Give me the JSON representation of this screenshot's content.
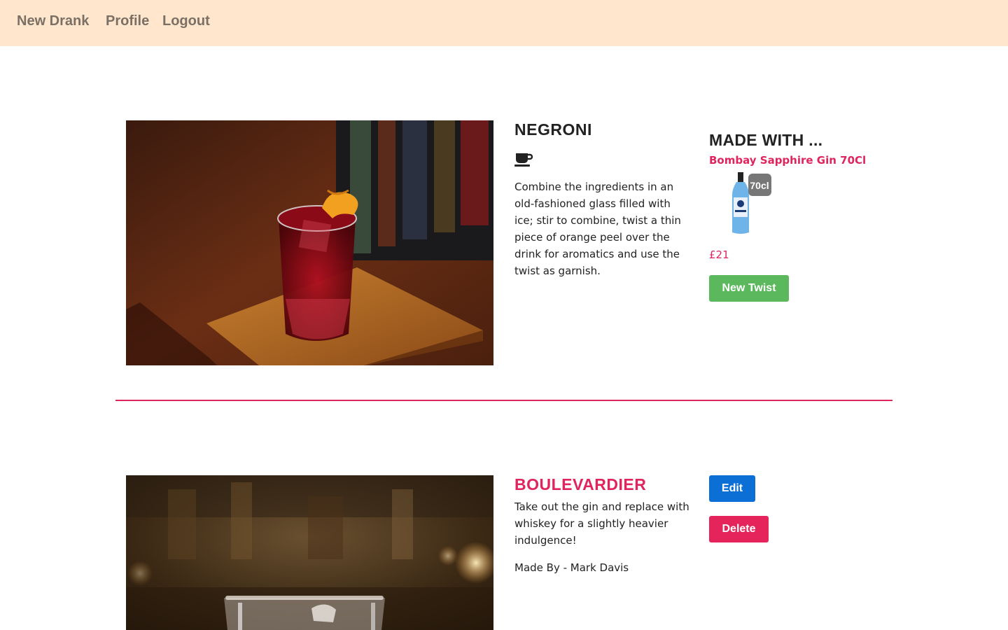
{
  "nav": {
    "links": [
      "New Drank",
      "Profile",
      "Logout"
    ]
  },
  "drinks": [
    {
      "title": "NEGRONI",
      "title_color": "#222222",
      "icon": "coffee-cup-icon",
      "description": "Combine the ingredients in an old-fashioned glass filled with ice; stir to combine, twist a thin piece of orange peel over the drink for aromatics and use the twist as garnish.",
      "image": "negroni-cocktail-photo",
      "made_with": {
        "heading": "MADE WITH ...",
        "product_name": "Bombay Sapphire Gin 70Cl",
        "bottle_badge": "70cl",
        "price": "£21"
      },
      "button": "New Twist"
    },
    {
      "title": "BOULEVARDIER",
      "title_color": "#e0245e",
      "description": "Take out the gin and replace with whiskey for a slightly heavier indulgence!",
      "made_by": "Made By - Mark Davis",
      "image": "boulevardier-cocktail-photo",
      "buttons": {
        "edit": "Edit",
        "delete": "Delete"
      }
    }
  ],
  "colors": {
    "nav_bg": "#ffe6cc",
    "accent": "#e0245e",
    "success": "#5cb85c",
    "primary": "#0b6fd6",
    "danger": "#e4245a"
  }
}
